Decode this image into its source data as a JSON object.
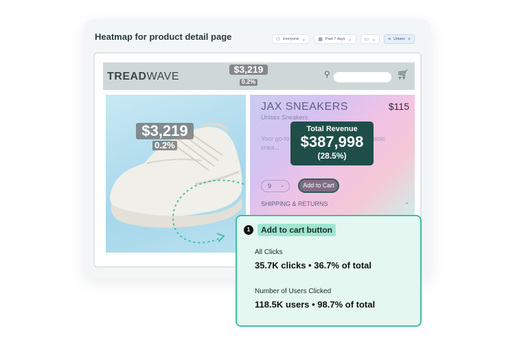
{
  "card": {
    "title": "Heatmap for product detail page",
    "filters": [
      {
        "icon": "user-icon",
        "label": "Everyone"
      },
      {
        "icon": "calendar-icon",
        "label": "Past 7 days"
      },
      {
        "icon": "monitor-icon",
        "label": ""
      },
      {
        "icon": "filter-icon",
        "label": "Unisex"
      }
    ]
  },
  "site": {
    "logo_bold": "TREAD",
    "logo_light": "WAVE",
    "header_overlay": {
      "amount": "$3,219",
      "percent": "0.2%"
    }
  },
  "image_overlay": {
    "amount": "$3,219",
    "percent": "0.2%"
  },
  "product": {
    "name": "JAX SNEAKERS",
    "price": "$115",
    "subtitle": "Unisex Sneakers",
    "description": "Your go-to classic sneakers. Rock this classic snea...",
    "quantity": "9",
    "add_to_cart": "Add to Cart",
    "shipping": "SHIPPING & RETURNS"
  },
  "total_revenue": {
    "label": "Total Revenue",
    "amount": "$387,998",
    "percent": "(28.5%)"
  },
  "tooltip": {
    "index": "1",
    "title": "Add to cart button",
    "sections": [
      {
        "label": "All Clicks",
        "value": "35.7K clicks • 36.7% of total"
      },
      {
        "label": "Number of Users Clicked",
        "value": "118.5K users • 98.7% of total"
      }
    ]
  },
  "colors": {
    "accent": "#3fbf9e",
    "revenue_bg": "#1f4e48",
    "tooltip_bg": "#e4f7f1"
  }
}
